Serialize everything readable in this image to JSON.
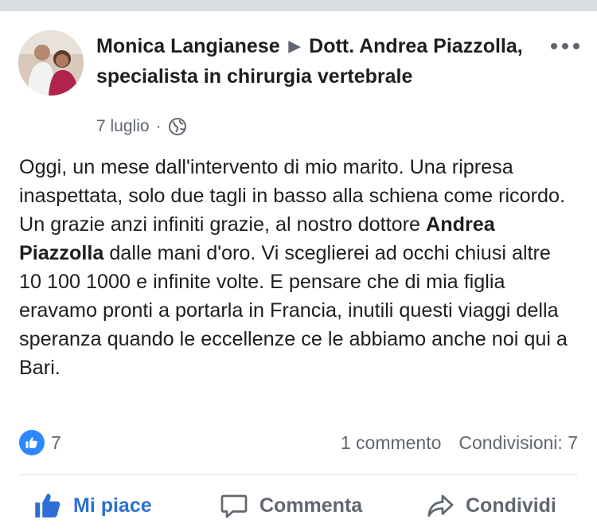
{
  "post": {
    "author": "Monica Langianese",
    "target": "Dott. Andrea Piazzolla, specialista in chirurgia vertebrale",
    "date": "7 luglio",
    "separator": "·",
    "text_part1": "Oggi, un mese dall'intervento di mio marito. Una ripresa inaspettata, solo due tagli in basso alla schiena come ricordo. Un grazie anzi infiniti grazie,  al nostro dottore ",
    "text_bold": "Andrea Piazzolla",
    "text_part2": " dalle mani d'oro. Vi sceglierei ad occhi chiusi altre 10 100 1000 e infinite volte. E pensare che di mia figlia eravamo pronti a portarla in Francia, inutili questi viaggi della speranza quando le eccellenze ce le abbiamo anche noi qui a Bari."
  },
  "stats": {
    "likes": "7",
    "comments": "1 commento",
    "shares": "Condivisioni: 7"
  },
  "actions": {
    "like": "Mi piace",
    "comment": "Commenta",
    "share": "Condividi"
  },
  "icons": {
    "avatar": "avatar-photo",
    "arrow": "right-arrow-icon",
    "globe": "globe-icon",
    "more": "more-options-icon",
    "like_badge": "thumbs-up-icon",
    "like_button": "thumbs-up-icon",
    "comment_button": "speech-bubble-icon",
    "share_button": "share-arrow-icon"
  },
  "colors": {
    "accent": "#2d6fd6",
    "badge": "#2d88ff",
    "secondary_text": "#606770",
    "divider": "#dadde1"
  }
}
